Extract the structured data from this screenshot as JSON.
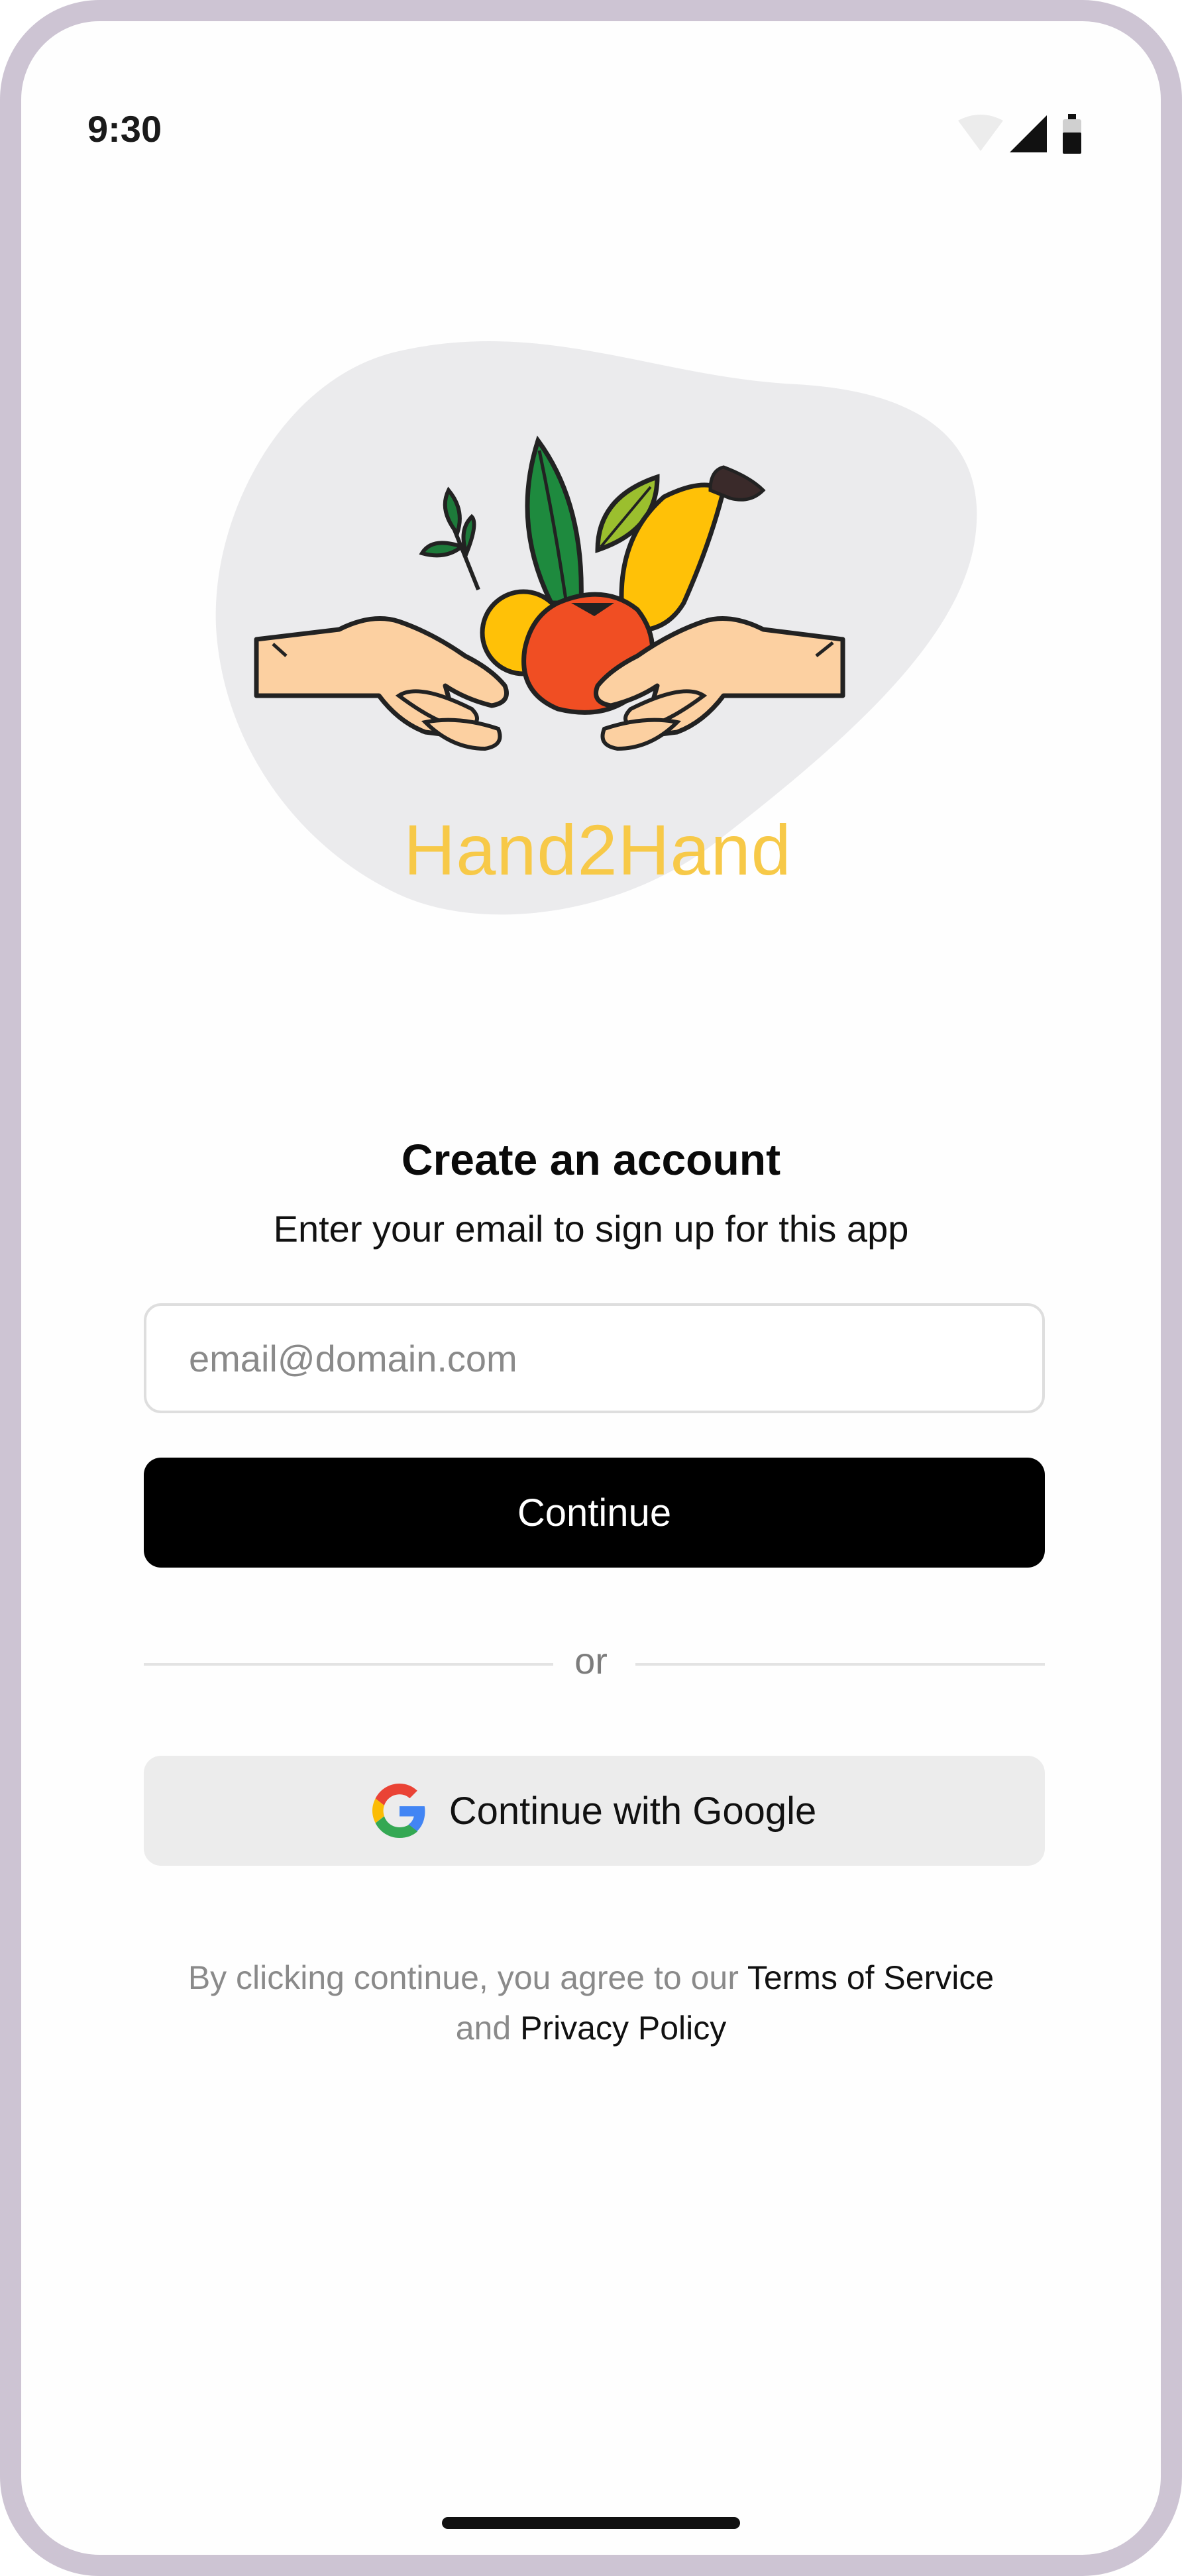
{
  "status_bar": {
    "time": "9:30",
    "icons": [
      "wifi-icon",
      "cellular-signal-icon",
      "battery-icon"
    ]
  },
  "brand": {
    "name": "Hand2Hand",
    "logo_icon": "hands-holding-produce-icon",
    "name_color": "#f7c948"
  },
  "signup": {
    "title": "Create an account",
    "subtitle": "Enter your email to sign up for this app",
    "email_placeholder": "email@domain.com",
    "email_value": "",
    "continue_label": "Continue",
    "divider_text": "or",
    "google_label": "Continue with Google",
    "google_icon": "google-logo-icon"
  },
  "legal": {
    "prefix": "By clicking continue, you agree to our ",
    "terms_label": "Terms of Service",
    "middle": "and ",
    "privacy_label": "Privacy Policy"
  },
  "colors": {
    "frame": "#cdc4d3",
    "primary_button": "#000000",
    "secondary_button": "#ececec",
    "logo_blob": "#ebebed"
  }
}
